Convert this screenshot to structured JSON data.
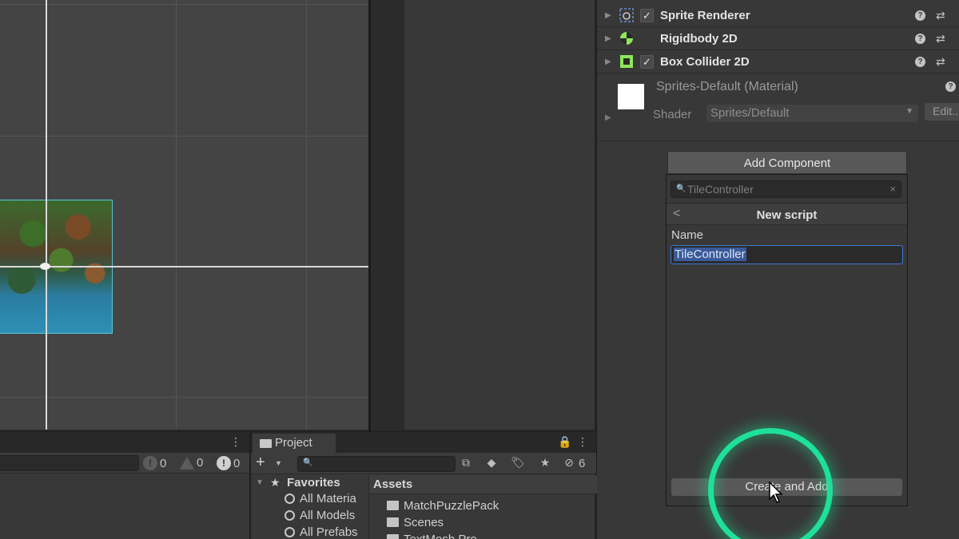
{
  "inspector": {
    "components": [
      {
        "name": "Sprite Renderer",
        "checked": true,
        "icon": "sprite-renderer-icon"
      },
      {
        "name": "Rigidbody 2D",
        "checked": false,
        "icon": "rigidbody-icon"
      },
      {
        "name": "Box Collider 2D",
        "checked": true,
        "icon": "box-collider-icon"
      }
    ],
    "help_glyph": "?",
    "settings_glyph": "⇄",
    "check_glyph": "✓",
    "fold_glyph": "▶",
    "material": {
      "title": "Sprites-Default (Material)",
      "shader_label": "Shader",
      "shader_value": "Sprites/Default",
      "edit_label": "Edit..."
    },
    "add_component_label": "Add Component"
  },
  "popup": {
    "search_value": "TileController",
    "clear_glyph": "×",
    "back_glyph": "<",
    "title": "New script",
    "name_label": "Name",
    "name_value": "TileController",
    "create_label": "Create and Add"
  },
  "console": {
    "menu_glyph": "⋮",
    "counts": [
      {
        "icon": "info-icon",
        "glyph": "!",
        "value": "0"
      },
      {
        "icon": "warning-icon",
        "glyph": "!",
        "value": "0"
      },
      {
        "icon": "error-icon",
        "glyph": "!",
        "value": "0"
      }
    ]
  },
  "project": {
    "tab_label": "Project",
    "lock_glyph": "🔒",
    "menu_glyph": "⋮",
    "plus_glyph": "+",
    "hidden_count": "6",
    "favorites_label": "Favorites",
    "favorites": [
      "All Materia",
      "All Models",
      "All Prefabs"
    ],
    "assets_label": "Assets",
    "assets": [
      "MatchPuzzlePack",
      "Scenes",
      "TextMesh Pro"
    ]
  },
  "colors": {
    "highlight_ring": "#1fe09a",
    "selection": "#3a5a99",
    "collider_green": "#8ee65a"
  }
}
